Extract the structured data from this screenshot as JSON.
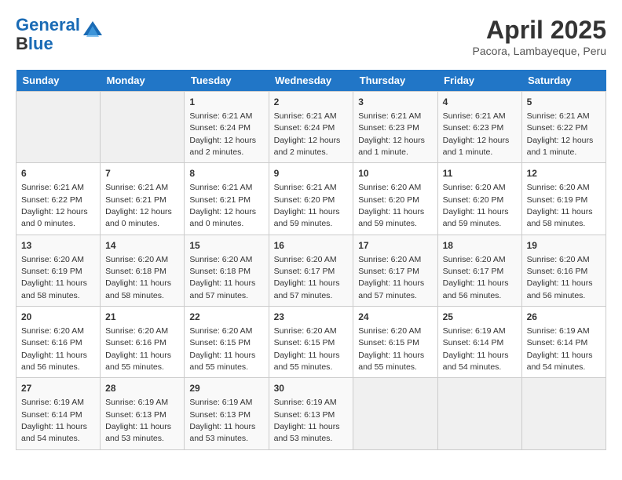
{
  "logo": {
    "line1": "General",
    "line2": "Blue"
  },
  "title": "April 2025",
  "subtitle": "Pacora, Lambayeque, Peru",
  "weekdays": [
    "Sunday",
    "Monday",
    "Tuesday",
    "Wednesday",
    "Thursday",
    "Friday",
    "Saturday"
  ],
  "weeks": [
    [
      {
        "day": "",
        "info": ""
      },
      {
        "day": "",
        "info": ""
      },
      {
        "day": "1",
        "info": "Sunrise: 6:21 AM\nSunset: 6:24 PM\nDaylight: 12 hours and 2 minutes."
      },
      {
        "day": "2",
        "info": "Sunrise: 6:21 AM\nSunset: 6:24 PM\nDaylight: 12 hours and 2 minutes."
      },
      {
        "day": "3",
        "info": "Sunrise: 6:21 AM\nSunset: 6:23 PM\nDaylight: 12 hours and 1 minute."
      },
      {
        "day": "4",
        "info": "Sunrise: 6:21 AM\nSunset: 6:23 PM\nDaylight: 12 hours and 1 minute."
      },
      {
        "day": "5",
        "info": "Sunrise: 6:21 AM\nSunset: 6:22 PM\nDaylight: 12 hours and 1 minute."
      }
    ],
    [
      {
        "day": "6",
        "info": "Sunrise: 6:21 AM\nSunset: 6:22 PM\nDaylight: 12 hours and 0 minutes."
      },
      {
        "day": "7",
        "info": "Sunrise: 6:21 AM\nSunset: 6:21 PM\nDaylight: 12 hours and 0 minutes."
      },
      {
        "day": "8",
        "info": "Sunrise: 6:21 AM\nSunset: 6:21 PM\nDaylight: 12 hours and 0 minutes."
      },
      {
        "day": "9",
        "info": "Sunrise: 6:21 AM\nSunset: 6:20 PM\nDaylight: 11 hours and 59 minutes."
      },
      {
        "day": "10",
        "info": "Sunrise: 6:20 AM\nSunset: 6:20 PM\nDaylight: 11 hours and 59 minutes."
      },
      {
        "day": "11",
        "info": "Sunrise: 6:20 AM\nSunset: 6:20 PM\nDaylight: 11 hours and 59 minutes."
      },
      {
        "day": "12",
        "info": "Sunrise: 6:20 AM\nSunset: 6:19 PM\nDaylight: 11 hours and 58 minutes."
      }
    ],
    [
      {
        "day": "13",
        "info": "Sunrise: 6:20 AM\nSunset: 6:19 PM\nDaylight: 11 hours and 58 minutes."
      },
      {
        "day": "14",
        "info": "Sunrise: 6:20 AM\nSunset: 6:18 PM\nDaylight: 11 hours and 58 minutes."
      },
      {
        "day": "15",
        "info": "Sunrise: 6:20 AM\nSunset: 6:18 PM\nDaylight: 11 hours and 57 minutes."
      },
      {
        "day": "16",
        "info": "Sunrise: 6:20 AM\nSunset: 6:17 PM\nDaylight: 11 hours and 57 minutes."
      },
      {
        "day": "17",
        "info": "Sunrise: 6:20 AM\nSunset: 6:17 PM\nDaylight: 11 hours and 57 minutes."
      },
      {
        "day": "18",
        "info": "Sunrise: 6:20 AM\nSunset: 6:17 PM\nDaylight: 11 hours and 56 minutes."
      },
      {
        "day": "19",
        "info": "Sunrise: 6:20 AM\nSunset: 6:16 PM\nDaylight: 11 hours and 56 minutes."
      }
    ],
    [
      {
        "day": "20",
        "info": "Sunrise: 6:20 AM\nSunset: 6:16 PM\nDaylight: 11 hours and 56 minutes."
      },
      {
        "day": "21",
        "info": "Sunrise: 6:20 AM\nSunset: 6:16 PM\nDaylight: 11 hours and 55 minutes."
      },
      {
        "day": "22",
        "info": "Sunrise: 6:20 AM\nSunset: 6:15 PM\nDaylight: 11 hours and 55 minutes."
      },
      {
        "day": "23",
        "info": "Sunrise: 6:20 AM\nSunset: 6:15 PM\nDaylight: 11 hours and 55 minutes."
      },
      {
        "day": "24",
        "info": "Sunrise: 6:20 AM\nSunset: 6:15 PM\nDaylight: 11 hours and 55 minutes."
      },
      {
        "day": "25",
        "info": "Sunrise: 6:19 AM\nSunset: 6:14 PM\nDaylight: 11 hours and 54 minutes."
      },
      {
        "day": "26",
        "info": "Sunrise: 6:19 AM\nSunset: 6:14 PM\nDaylight: 11 hours and 54 minutes."
      }
    ],
    [
      {
        "day": "27",
        "info": "Sunrise: 6:19 AM\nSunset: 6:14 PM\nDaylight: 11 hours and 54 minutes."
      },
      {
        "day": "28",
        "info": "Sunrise: 6:19 AM\nSunset: 6:13 PM\nDaylight: 11 hours and 53 minutes."
      },
      {
        "day": "29",
        "info": "Sunrise: 6:19 AM\nSunset: 6:13 PM\nDaylight: 11 hours and 53 minutes."
      },
      {
        "day": "30",
        "info": "Sunrise: 6:19 AM\nSunset: 6:13 PM\nDaylight: 11 hours and 53 minutes."
      },
      {
        "day": "",
        "info": ""
      },
      {
        "day": "",
        "info": ""
      },
      {
        "day": "",
        "info": ""
      }
    ]
  ]
}
